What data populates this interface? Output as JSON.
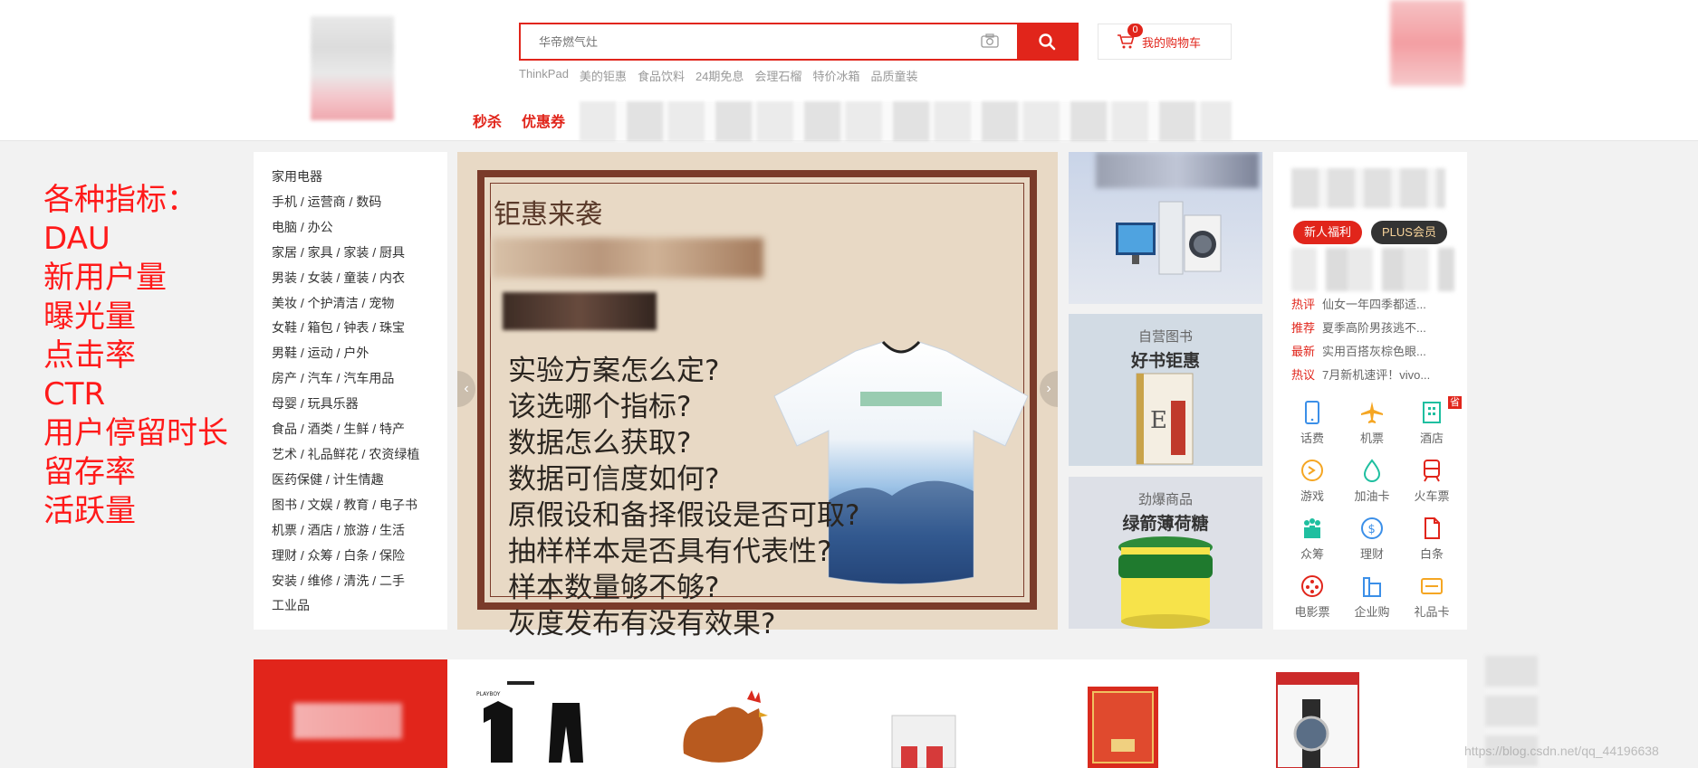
{
  "search": {
    "placeholder": "华帝燃气灶"
  },
  "cart": {
    "label": "我的购物车",
    "count": "0"
  },
  "hotwords": [
    "ThinkPad",
    "美的钜惠",
    "食品饮料",
    "24期免息",
    "会理石榴",
    "特价冰箱",
    "品质童装"
  ],
  "nav": [
    "秒杀",
    "优惠券"
  ],
  "metrics": [
    "各种指标：",
    "DAU",
    "新用户量",
    "曝光量",
    "点击率",
    "CTR",
    "用户停留时长",
    "留存率",
    "活跃量"
  ],
  "categories": [
    "家用电器",
    "手机 / 运营商 / 数码",
    "电脑 / 办公",
    "家居 / 家具 / 家装 / 厨具",
    "男装 / 女装 / 童装 / 内衣",
    "美妆 / 个护清洁 / 宠物",
    "女鞋 / 箱包 / 钟表 / 珠宝",
    "男鞋 / 运动 / 户外",
    "房产 / 汽车 / 汽车用品",
    "母婴 / 玩具乐器",
    "食品 / 酒类 / 生鲜 / 特产",
    "艺术 / 礼品鲜花 / 农资绿植",
    "医药保健 / 计生情趣",
    "图书 / 文娱 / 教育 / 电子书",
    "机票 / 酒店 / 旅游 / 生活",
    "理财 / 众筹 / 白条 / 保险",
    "安装 / 维修 / 清洗 / 二手",
    "工业品"
  ],
  "banner": {
    "title": "钜惠来袭",
    "lines": [
      "实验方案怎么定?",
      "该选哪个指标?",
      "数据怎么获取?",
      "数据可信度如何?",
      "原假设和备择假设是否可取?",
      "抽样样本是否具有代表性?",
      "样本数量够不够?",
      "灰度发布有没有效果?"
    ]
  },
  "promos": [
    {
      "sub": "",
      "title": ""
    },
    {
      "sub": "自营图书",
      "title": "好书钜惠"
    },
    {
      "sub": "劲爆商品",
      "title": "绿箭薄荷糖"
    }
  ],
  "side": {
    "tag_new": "新人福利",
    "tag_plus": "PLUS会员",
    "news": [
      {
        "tag": "热评",
        "text": "仙女一年四季都适..."
      },
      {
        "tag": "推荐",
        "text": "夏季高阶男孩逃不..."
      },
      {
        "tag": "最新",
        "text": "实用百搭灰棕色眼..."
      },
      {
        "tag": "热议",
        "text": "7月新机速评！vivo..."
      }
    ],
    "services": [
      {
        "label": "话费",
        "icon": "phone-icon",
        "color": "#3b8fe8"
      },
      {
        "label": "机票",
        "icon": "plane-icon",
        "color": "#f5a623"
      },
      {
        "label": "酒店",
        "icon": "hotel-icon",
        "color": "#1fbfa0",
        "badge": "省"
      },
      {
        "label": "游戏",
        "icon": "game-icon",
        "color": "#f5a623"
      },
      {
        "label": "加油卡",
        "icon": "fuel-icon",
        "color": "#1fbfa0"
      },
      {
        "label": "火车票",
        "icon": "train-icon",
        "color": "#e1251b"
      },
      {
        "label": "众筹",
        "icon": "crowdfund-icon",
        "color": "#1fbfa0"
      },
      {
        "label": "理财",
        "icon": "finance-icon",
        "color": "#3b8fe8"
      },
      {
        "label": "白条",
        "icon": "credit-icon",
        "color": "#e1251b"
      },
      {
        "label": "电影票",
        "icon": "film-icon",
        "color": "#e1251b"
      },
      {
        "label": "企业购",
        "icon": "enterprise-icon",
        "color": "#3b8fe8"
      },
      {
        "label": "礼品卡",
        "icon": "giftcard-icon",
        "color": "#f5a623"
      }
    ]
  },
  "watermark": "https://blog.csdn.net/qq_44196638",
  "colors": {
    "accent": "#e1251b",
    "metrics_text": "#ff1a1a"
  }
}
